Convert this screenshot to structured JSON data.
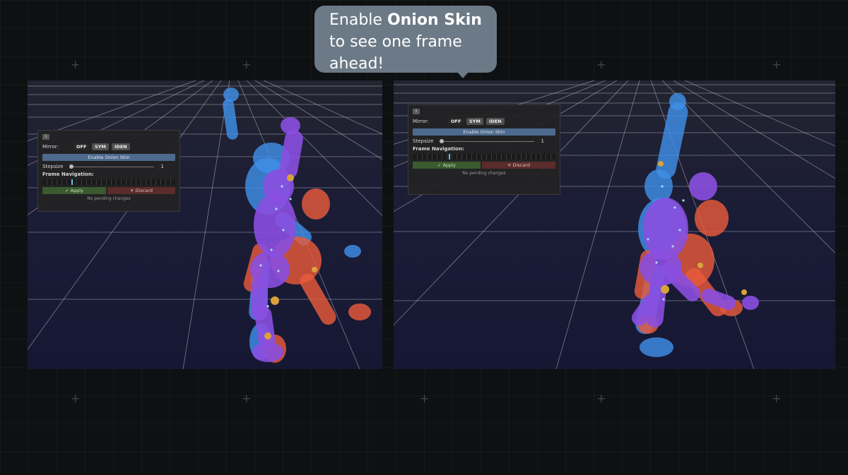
{
  "callout": {
    "line1_prefix": "Enable ",
    "line1_bold": "Onion Skin",
    "line2": "to see one frame",
    "line3": "ahead!"
  },
  "panel_left": {
    "collapse_label": "I",
    "mirror_label": "Mirror:",
    "mirror_options": [
      "OFF",
      "SYM",
      "IDEN"
    ],
    "onion_button": "Enable Onion Skin",
    "stepsize_label": "Stepsize",
    "stepsize_value": "1",
    "frame_nav_label": "Frame Navigation:",
    "frame_cursor_fraction": 0.22,
    "apply_label": "✓ Apply",
    "discard_label": "✕ Discard",
    "pending_text": "No pending changes"
  },
  "panel_right": {
    "collapse_label": "I",
    "mirror_label": "Mirror:",
    "mirror_options": [
      "OFF",
      "SYM",
      "IDEN"
    ],
    "onion_button": "Enable Onion Skin",
    "stepsize_label": "Stepsize",
    "stepsize_value": "1",
    "frame_nav_label": "Frame Navigation:",
    "frame_cursor_fraction": 0.25,
    "apply_label": "✓ Apply",
    "discard_label": "✕ Discard",
    "pending_text": "No pending changes"
  },
  "colors": {
    "onion_ahead": "#3f8fe8",
    "onion_behind": "#e85a3c",
    "current_pose": "#8a4fe0",
    "joint": "#d9a23a",
    "onion_button": "#4d6a8e",
    "apply": "#3b5a2f",
    "discard": "#5a2c2a"
  }
}
